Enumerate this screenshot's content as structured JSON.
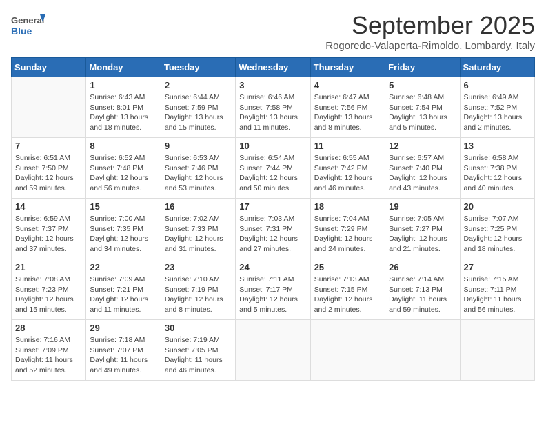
{
  "header": {
    "logo_general": "General",
    "logo_blue": "Blue",
    "month": "September 2025",
    "location": "Rogoredo-Valaperta-Rimoldo, Lombardy, Italy"
  },
  "columns": [
    "Sunday",
    "Monday",
    "Tuesday",
    "Wednesday",
    "Thursday",
    "Friday",
    "Saturday"
  ],
  "weeks": [
    [
      {
        "day": "",
        "text": ""
      },
      {
        "day": "1",
        "text": "Sunrise: 6:43 AM\nSunset: 8:01 PM\nDaylight: 13 hours\nand 18 minutes."
      },
      {
        "day": "2",
        "text": "Sunrise: 6:44 AM\nSunset: 7:59 PM\nDaylight: 13 hours\nand 15 minutes."
      },
      {
        "day": "3",
        "text": "Sunrise: 6:46 AM\nSunset: 7:58 PM\nDaylight: 13 hours\nand 11 minutes."
      },
      {
        "day": "4",
        "text": "Sunrise: 6:47 AM\nSunset: 7:56 PM\nDaylight: 13 hours\nand 8 minutes."
      },
      {
        "day": "5",
        "text": "Sunrise: 6:48 AM\nSunset: 7:54 PM\nDaylight: 13 hours\nand 5 minutes."
      },
      {
        "day": "6",
        "text": "Sunrise: 6:49 AM\nSunset: 7:52 PM\nDaylight: 13 hours\nand 2 minutes."
      }
    ],
    [
      {
        "day": "7",
        "text": "Sunrise: 6:51 AM\nSunset: 7:50 PM\nDaylight: 12 hours\nand 59 minutes."
      },
      {
        "day": "8",
        "text": "Sunrise: 6:52 AM\nSunset: 7:48 PM\nDaylight: 12 hours\nand 56 minutes."
      },
      {
        "day": "9",
        "text": "Sunrise: 6:53 AM\nSunset: 7:46 PM\nDaylight: 12 hours\nand 53 minutes."
      },
      {
        "day": "10",
        "text": "Sunrise: 6:54 AM\nSunset: 7:44 PM\nDaylight: 12 hours\nand 50 minutes."
      },
      {
        "day": "11",
        "text": "Sunrise: 6:55 AM\nSunset: 7:42 PM\nDaylight: 12 hours\nand 46 minutes."
      },
      {
        "day": "12",
        "text": "Sunrise: 6:57 AM\nSunset: 7:40 PM\nDaylight: 12 hours\nand 43 minutes."
      },
      {
        "day": "13",
        "text": "Sunrise: 6:58 AM\nSunset: 7:38 PM\nDaylight: 12 hours\nand 40 minutes."
      }
    ],
    [
      {
        "day": "14",
        "text": "Sunrise: 6:59 AM\nSunset: 7:37 PM\nDaylight: 12 hours\nand 37 minutes."
      },
      {
        "day": "15",
        "text": "Sunrise: 7:00 AM\nSunset: 7:35 PM\nDaylight: 12 hours\nand 34 minutes."
      },
      {
        "day": "16",
        "text": "Sunrise: 7:02 AM\nSunset: 7:33 PM\nDaylight: 12 hours\nand 31 minutes."
      },
      {
        "day": "17",
        "text": "Sunrise: 7:03 AM\nSunset: 7:31 PM\nDaylight: 12 hours\nand 27 minutes."
      },
      {
        "day": "18",
        "text": "Sunrise: 7:04 AM\nSunset: 7:29 PM\nDaylight: 12 hours\nand 24 minutes."
      },
      {
        "day": "19",
        "text": "Sunrise: 7:05 AM\nSunset: 7:27 PM\nDaylight: 12 hours\nand 21 minutes."
      },
      {
        "day": "20",
        "text": "Sunrise: 7:07 AM\nSunset: 7:25 PM\nDaylight: 12 hours\nand 18 minutes."
      }
    ],
    [
      {
        "day": "21",
        "text": "Sunrise: 7:08 AM\nSunset: 7:23 PM\nDaylight: 12 hours\nand 15 minutes."
      },
      {
        "day": "22",
        "text": "Sunrise: 7:09 AM\nSunset: 7:21 PM\nDaylight: 12 hours\nand 11 minutes."
      },
      {
        "day": "23",
        "text": "Sunrise: 7:10 AM\nSunset: 7:19 PM\nDaylight: 12 hours\nand 8 minutes."
      },
      {
        "day": "24",
        "text": "Sunrise: 7:11 AM\nSunset: 7:17 PM\nDaylight: 12 hours\nand 5 minutes."
      },
      {
        "day": "25",
        "text": "Sunrise: 7:13 AM\nSunset: 7:15 PM\nDaylight: 12 hours\nand 2 minutes."
      },
      {
        "day": "26",
        "text": "Sunrise: 7:14 AM\nSunset: 7:13 PM\nDaylight: 11 hours\nand 59 minutes."
      },
      {
        "day": "27",
        "text": "Sunrise: 7:15 AM\nSunset: 7:11 PM\nDaylight: 11 hours\nand 56 minutes."
      }
    ],
    [
      {
        "day": "28",
        "text": "Sunrise: 7:16 AM\nSunset: 7:09 PM\nDaylight: 11 hours\nand 52 minutes."
      },
      {
        "day": "29",
        "text": "Sunrise: 7:18 AM\nSunset: 7:07 PM\nDaylight: 11 hours\nand 49 minutes."
      },
      {
        "day": "30",
        "text": "Sunrise: 7:19 AM\nSunset: 7:05 PM\nDaylight: 11 hours\nand 46 minutes."
      },
      {
        "day": "",
        "text": ""
      },
      {
        "day": "",
        "text": ""
      },
      {
        "day": "",
        "text": ""
      },
      {
        "day": "",
        "text": ""
      }
    ]
  ]
}
